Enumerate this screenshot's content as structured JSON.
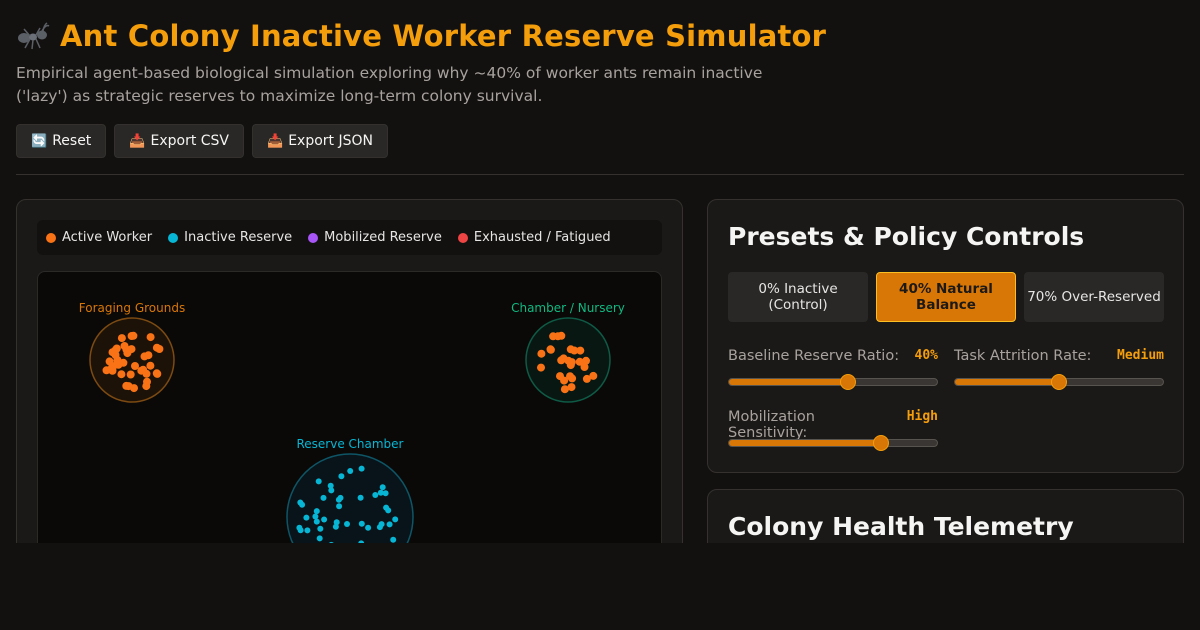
{
  "header": {
    "icon": "ant-icon",
    "title": "Ant Colony Inactive Worker Reserve Simulator",
    "subtitle": "Empirical agent-based biological simulation exploring why ~40% of worker ants remain inactive ('lazy') as strategic reserves to maximize long-term colony survival."
  },
  "toolbar": {
    "reset": {
      "icon": "🔄",
      "label": "Reset"
    },
    "export_csv": {
      "icon": "📥",
      "label": "Export CSV"
    },
    "export_json": {
      "icon": "📥",
      "label": "Export JSON"
    }
  },
  "legend": [
    {
      "label": "Active Worker",
      "color": "#f97316"
    },
    {
      "label": "Inactive Reserve",
      "color": "#06b6d4"
    },
    {
      "label": "Mobilized Reserve",
      "color": "#a855f7"
    },
    {
      "label": "Exhausted / Fatigued",
      "color": "#ef4444"
    }
  ],
  "zones": {
    "foraging": "Foraging Grounds",
    "nursery": "Chamber / Nursery",
    "reserve": "Reserve Chamber"
  },
  "controls": {
    "title": "Presets & Policy Controls",
    "presets": [
      {
        "label": "0% Inactive (Control)",
        "active": false
      },
      {
        "label": "40% Natural Balance",
        "active": true
      },
      {
        "label": "70% Over-Reserved",
        "active": false
      }
    ],
    "sliders": [
      {
        "label": "Baseline Reserve Ratio:",
        "value": "40%",
        "level": 0.57
      },
      {
        "label": "Task Attrition Rate:",
        "value": "Medium",
        "level": 0.5
      },
      {
        "label": "Mobilization Sensitivity:",
        "value": "High",
        "level": 0.73
      }
    ]
  },
  "telemetry": {
    "title": "Colony Health Telemetry"
  }
}
